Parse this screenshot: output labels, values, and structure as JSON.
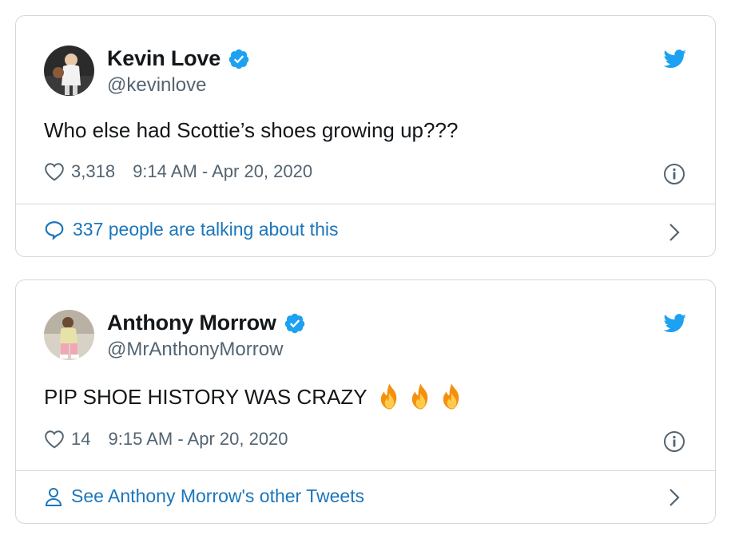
{
  "tweets": [
    {
      "name": "Kevin Love",
      "handle": "@kevinlove",
      "text": "Who else had Scottie’s shoes growing up???",
      "likes": "3,318",
      "timestamp": "9:14 AM - Apr 20, 2020",
      "footer": "337 people are talking about this",
      "footer_icon": "speech-bubble-icon"
    },
    {
      "name": "Anthony Morrow",
      "handle": "@MrAnthonyMorrow",
      "text": "PIP SHOE HISTORY WAS CRAZY",
      "emoji": [
        "fire-emoji",
        "fire-emoji",
        "fire-emoji"
      ],
      "likes": "14",
      "timestamp": "9:15 AM - Apr 20, 2020",
      "footer": "See Anthony Morrow's other Tweets",
      "footer_icon": "person-icon"
    }
  ],
  "colors": {
    "brand_blue": "#1da1f2",
    "link_blue": "#1b76bb",
    "text": "#14171a",
    "muted": "#536471",
    "border": "#cfd9de"
  }
}
